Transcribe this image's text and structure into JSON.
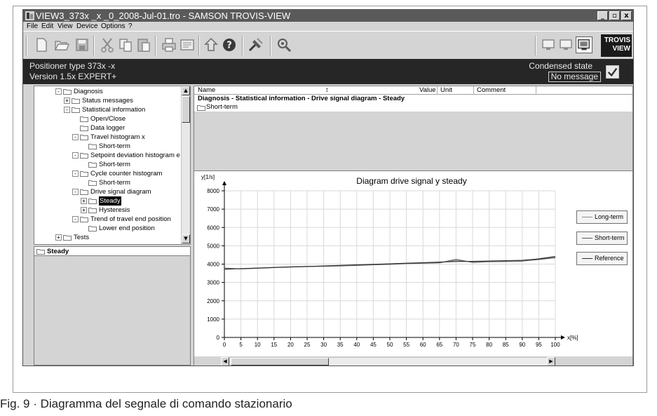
{
  "window": {
    "title": "VIEW3_373x _x _0_2008-Jul-01.tro - SAMSON TROVIS-VIEW",
    "controls": [
      "_",
      "▫",
      "x"
    ]
  },
  "menu": [
    "File",
    "Edit",
    "View",
    "Device",
    "Options",
    "?"
  ],
  "toolbar_icons": [
    "new-icon",
    "open-icon",
    "save-icon",
    "cut-icon",
    "copy-icon",
    "paste-icon",
    "print-icon",
    "preview-icon",
    "upload-icon",
    "help-icon",
    "tools-icon",
    "device-icon",
    "monitor-icon",
    "monitor-icon",
    "display-icon"
  ],
  "logo": {
    "line1": "TROVIS",
    "line2": "VIEW"
  },
  "device_info": {
    "type": "Positioner type 373x -x",
    "version": "Version 1.5x EXPERT+",
    "condensed_label": "Condensed state",
    "message": "No message",
    "ok": true
  },
  "tree": [
    {
      "label": "Diagnosis",
      "level": 1,
      "toggle": "-"
    },
    {
      "label": "Status messages",
      "level": 2,
      "toggle": "+"
    },
    {
      "label": "Statistical information",
      "level": 2,
      "toggle": "-"
    },
    {
      "label": "Open/Close",
      "level": 3,
      "toggle": ""
    },
    {
      "label": "Data logger",
      "level": 3,
      "toggle": ""
    },
    {
      "label": "Travel histogram x",
      "level": 3,
      "toggle": "-"
    },
    {
      "label": "Short-term",
      "level": 4,
      "toggle": ""
    },
    {
      "label": "Setpoint deviation histogram e",
      "level": 3,
      "toggle": "-"
    },
    {
      "label": "Short-term",
      "level": 4,
      "toggle": ""
    },
    {
      "label": "Cycle counter histogram",
      "level": 3,
      "toggle": "-"
    },
    {
      "label": "Short-term",
      "level": 4,
      "toggle": ""
    },
    {
      "label": "Drive signal diagram",
      "level": 3,
      "toggle": "-"
    },
    {
      "label": "Steady",
      "level": 4,
      "toggle": "+",
      "selected": true
    },
    {
      "label": "Hysteresis",
      "level": 4,
      "toggle": "+"
    },
    {
      "label": "Trend of travel end position",
      "level": 3,
      "toggle": "-"
    },
    {
      "label": "Lower end position",
      "level": 4,
      "toggle": ""
    },
    {
      "label": "Tests",
      "level": 1,
      "toggle": "+"
    }
  ],
  "detail_panel": {
    "title": "Steady"
  },
  "table": {
    "columns": [
      "Name",
      "Value",
      "Unit",
      "Comment"
    ],
    "sort_glyph": "↕",
    "path": "Diagnosis - Statistical information - Drive signal diagram - Steady",
    "rows": [
      "Short-term"
    ]
  },
  "legend": [
    "Long-term",
    "Short-term",
    "Reference"
  ],
  "caption": "Fig. 9 · Diagramma del segnale di comando stazionario",
  "chart_data": {
    "type": "line",
    "title": "Diagram drive signal y steady",
    "ylabel": "y[1/s]",
    "xlabel": "x[%]",
    "xlim": [
      0,
      100
    ],
    "ylim": [
      0,
      8000
    ],
    "xticks": [
      0,
      5,
      10,
      15,
      20,
      25,
      30,
      35,
      40,
      45,
      50,
      55,
      60,
      65,
      70,
      75,
      80,
      85,
      90,
      95,
      100
    ],
    "yticks": [
      0,
      1000,
      2000,
      3000,
      4000,
      5000,
      6000,
      7000,
      8000
    ],
    "grid": true,
    "x": [
      0,
      5,
      10,
      15,
      20,
      25,
      30,
      35,
      40,
      45,
      50,
      55,
      60,
      65,
      70,
      75,
      80,
      85,
      90,
      95,
      100
    ],
    "series": [
      {
        "name": "Long-term",
        "color": "#8c8c8c",
        "values": [
          3730,
          3760,
          3790,
          3820,
          3850,
          3880,
          3890,
          3920,
          3950,
          3980,
          4010,
          4040,
          4060,
          4080,
          4200,
          4120,
          4140,
          4150,
          4160,
          4300,
          4430
        ]
      },
      {
        "name": "Short-term",
        "color": "#5a5a5a",
        "values": [
          3780,
          3740,
          3770,
          3810,
          3840,
          3870,
          3880,
          3900,
          3930,
          3960,
          3990,
          4030,
          4050,
          4070,
          4260,
          4090,
          4130,
          4140,
          4170,
          4250,
          4350
        ]
      },
      {
        "name": "Reference",
        "color": "#2e2e2e",
        "values": [
          3720,
          3750,
          3780,
          3820,
          3850,
          3870,
          3900,
          3930,
          3960,
          3990,
          4020,
          4050,
          4080,
          4110,
          4140,
          4150,
          4170,
          4190,
          4210,
          4280,
          4400
        ]
      }
    ]
  }
}
